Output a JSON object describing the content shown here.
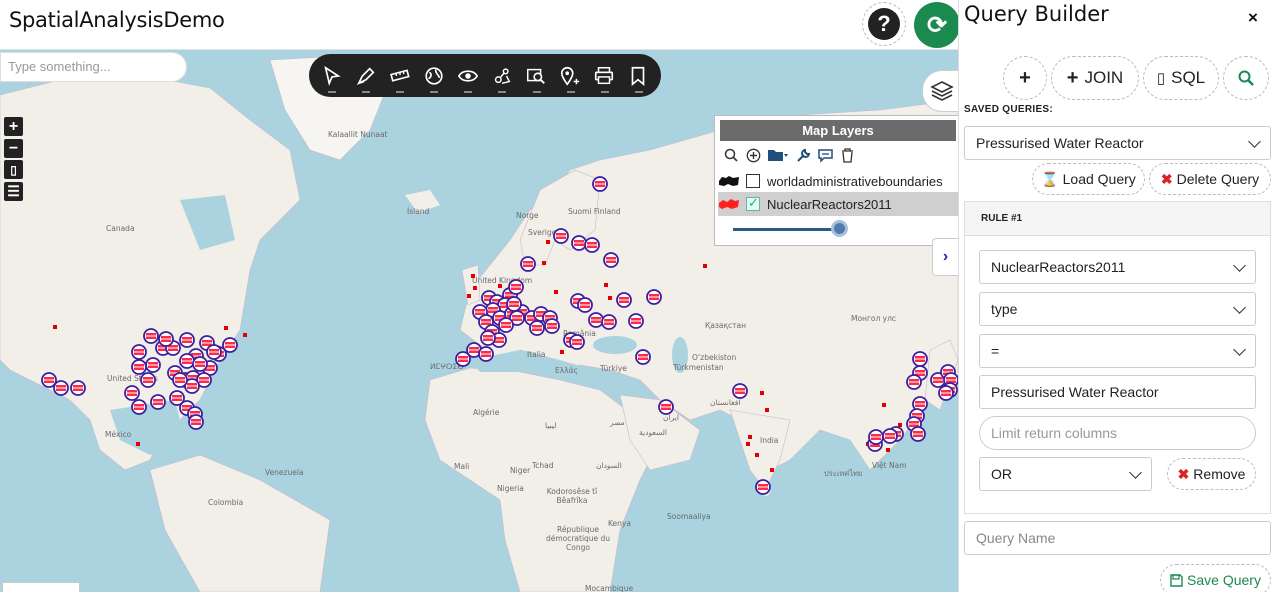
{
  "app": {
    "title": "SpatialAnalysisDemo"
  },
  "header": {
    "help_icon": "question-mark-icon",
    "refresh_icon": "refresh-icon",
    "refresh_color": "#1b8a4f"
  },
  "search": {
    "placeholder": "Type something..."
  },
  "toolbar": {
    "tools": [
      "select-icon",
      "draw-icon",
      "measure-icon",
      "globe-icon",
      "view-icon",
      "analysis-icon",
      "query-icon",
      "location-icon",
      "print-icon",
      "bookmark-icon"
    ]
  },
  "map_controls": {
    "zoom_in": "+",
    "zoom_out": "−",
    "fullscreen": "▯",
    "legend": "☰"
  },
  "map_labels": [
    {
      "text": "Kalaallit Nunaat",
      "cls": ""
    },
    {
      "text": "Ísland",
      "cls": ""
    },
    {
      "text": "Canada",
      "cls": ""
    },
    {
      "text": "United States",
      "cls": ""
    },
    {
      "text": "México",
      "cls": ""
    },
    {
      "text": "Colombia",
      "cls": ""
    },
    {
      "text": "Venezuela",
      "cls": ""
    },
    {
      "text": "Norge",
      "cls": ""
    },
    {
      "text": "Sverige",
      "cls": ""
    },
    {
      "text": "Suomi Finland",
      "cls": ""
    },
    {
      "text": "United Kingdom",
      "cls": ""
    },
    {
      "text": "România",
      "cls": ""
    },
    {
      "text": "Italia",
      "cls": ""
    },
    {
      "text": "Ελλάς",
      "cls": ""
    },
    {
      "text": "Türkiye",
      "cls": ""
    },
    {
      "text": "Қазақстан",
      "cls": ""
    },
    {
      "text": "Монгол улс",
      "cls": ""
    },
    {
      "text": "Oʻzbekiston",
      "cls": ""
    },
    {
      "text": "Türkmenistan",
      "cls": ""
    },
    {
      "text": "ایران",
      "cls": ""
    },
    {
      "text": "افغانستان",
      "cls": ""
    },
    {
      "text": "India",
      "cls": ""
    },
    {
      "text": "ประเทศไทย",
      "cls": ""
    },
    {
      "text": "Việt Nam",
      "cls": ""
    },
    {
      "text": "Algérie",
      "cls": ""
    },
    {
      "text": "ليبيا",
      "cls": ""
    },
    {
      "text": "مصر",
      "cls": ""
    },
    {
      "text": "السعودية",
      "cls": ""
    },
    {
      "text": "Mali",
      "cls": ""
    },
    {
      "text": "Niger",
      "cls": ""
    },
    {
      "text": "Tchad",
      "cls": ""
    },
    {
      "text": "السودان",
      "cls": ""
    },
    {
      "text": "Nigeria",
      "cls": ""
    },
    {
      "text": "Kenya",
      "cls": ""
    },
    {
      "text": "République démocratique du Congo",
      "cls": ""
    },
    {
      "text": "Mocambique",
      "cls": ""
    },
    {
      "text": "Soomaaliya",
      "cls": ""
    },
    {
      "text": "Kodorosêse tî Bêafrîka",
      "cls": ""
    },
    {
      "text": "ⵍⵎⵖⵔⵉⴱ",
      "cls": ""
    }
  ],
  "layers": {
    "title": "Map Layers",
    "tools": [
      "search-icon",
      "add-icon",
      "folder-icon",
      "wrench-icon",
      "comment-icon",
      "trash-icon"
    ],
    "items": [
      {
        "name": "worldadministrativeboundaries",
        "checked": false
      },
      {
        "name": "NuclearReactors2011",
        "checked": true
      }
    ],
    "opacity": 0.88
  },
  "query_builder": {
    "title": "Query Builder",
    "close": "×",
    "add_label": "+",
    "join_label": "JOIN",
    "sql_label": "SQL",
    "saved_label": "SAVED QUERIES:",
    "saved_value": "Pressurised Water Reactor",
    "load_label": "Load Query",
    "delete_label": "Delete Query",
    "rule_title": "RULE #1",
    "layer_value": "NuclearReactors2011",
    "field_value": "type",
    "operator_value": "=",
    "value_text": "Pressurised Water Reactor",
    "limit_placeholder": "Limit return columns",
    "logic_value": "OR",
    "remove_label": "Remove",
    "name_placeholder": "Query Name",
    "save_label": "Save Query"
  },
  "colors": {
    "marker_ring": "#3b1f9e",
    "marker_fill": "#ff2a4a",
    "marker_square": "#e00000",
    "water": "#aad3df",
    "land": "#f2efe9"
  }
}
